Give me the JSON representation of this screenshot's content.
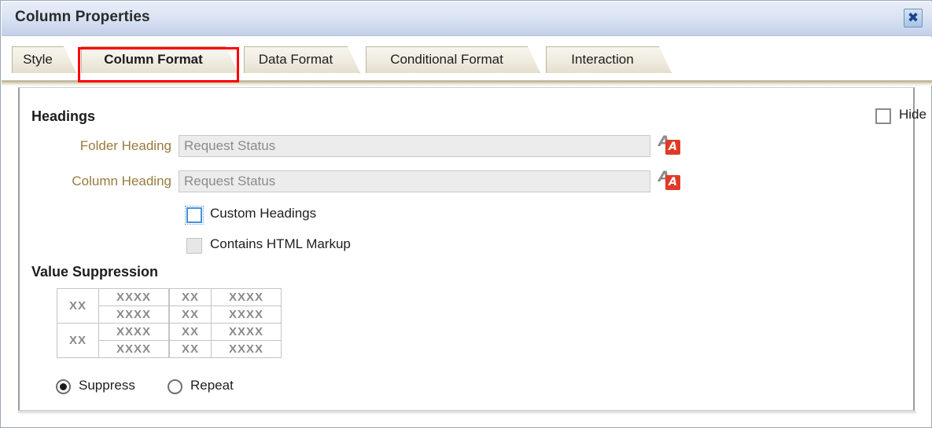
{
  "window": {
    "title": "Column Properties",
    "close_icon": "close-x-icon"
  },
  "tabs": [
    {
      "label": "Style",
      "active": false
    },
    {
      "label": "Column Format",
      "active": true
    },
    {
      "label": "Data Format",
      "active": false
    },
    {
      "label": "Conditional Format",
      "active": false
    },
    {
      "label": "Interaction",
      "active": false
    }
  ],
  "annotation": {
    "highlight_color": "#ff0000",
    "target_tab": "Column Format"
  },
  "headings": {
    "section_title": "Headings",
    "hide": {
      "label": "Hide",
      "checked": false
    },
    "folder_heading": {
      "label": "Folder Heading",
      "value": "Request Status",
      "placeholder": "",
      "disabled": true,
      "icon": "variable-a-icon"
    },
    "column_heading": {
      "label": "Column Heading",
      "value": "Request Status",
      "placeholder": "",
      "disabled": true,
      "icon": "variable-a-icon"
    },
    "custom_headings": {
      "label": "Custom Headings",
      "checked": false,
      "focused": true
    },
    "contains_html_markup": {
      "label": "Contains HTML Markup",
      "checked": false,
      "disabled": true
    }
  },
  "value_suppression": {
    "section_title": "Value Suppression",
    "suppress_preview": {
      "left_cells": [
        "XX",
        "XX"
      ],
      "right_cells": [
        "XXXX",
        "XXXX",
        "XXXX",
        "XXXX"
      ]
    },
    "repeat_preview": {
      "left_cells": [
        "XX",
        "XX",
        "XX",
        "XX"
      ],
      "right_cells": [
        "XXXX",
        "XXXX",
        "XXXX",
        "XXXX"
      ]
    },
    "options": [
      {
        "label": "Suppress",
        "selected": true
      },
      {
        "label": "Repeat",
        "selected": false
      }
    ]
  },
  "colors": {
    "label_gold": "#977c3c",
    "title_bar": "#dbe4f4",
    "tab_face": "#efebdf",
    "annotation_red": "#ff0000",
    "icon_red": "#e03a26"
  }
}
